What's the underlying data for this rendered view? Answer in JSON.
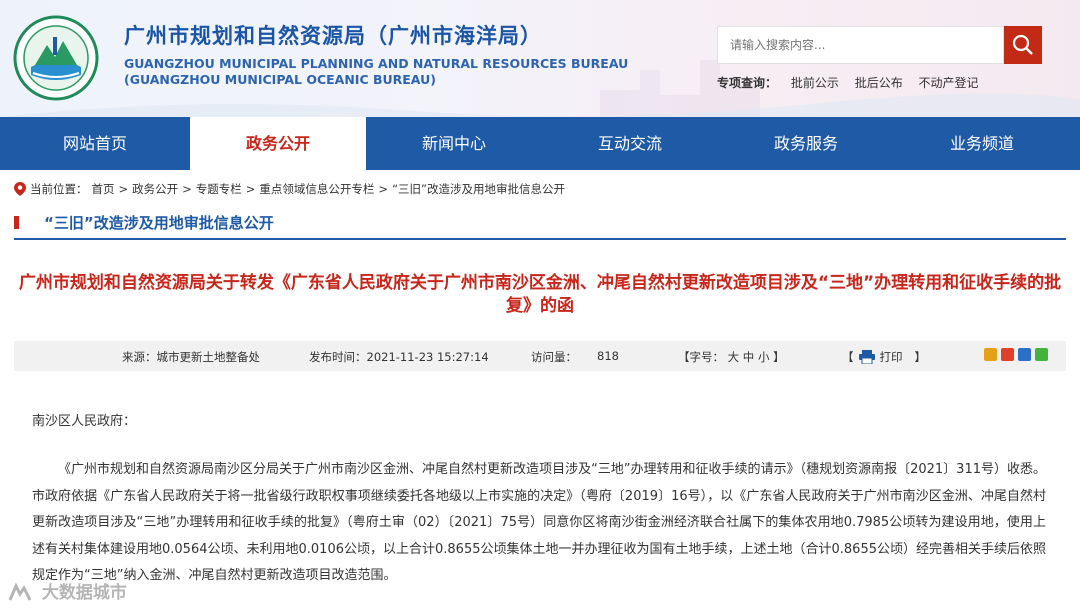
{
  "header": {
    "title": "广州市规划和自然资源局（广州市海洋局）",
    "title_en_1": "GUANGZHOU MUNICIPAL PLANNING AND NATURAL RESOURCES BUREAU",
    "title_en_2": "(GUANGZHOU MUNICIPAL OCEANIC BUREAU)",
    "search_placeholder": "请输入搜索内容...",
    "special_label": "专项查询：",
    "special_links": [
      "批前公示",
      "批后公布",
      "不动产登记"
    ]
  },
  "nav": {
    "items": [
      "网站首页",
      "政务公开",
      "新闻中心",
      "互动交流",
      "政务服务",
      "业务频道"
    ],
    "active_index": 1
  },
  "breadcrumb": {
    "label": "当前位置：",
    "items": [
      "首页",
      ">",
      "政务公开",
      ">",
      "专题专栏",
      ">",
      "重点领域信息公开专栏",
      ">",
      "“三旧”改造涉及用地审批信息公开"
    ]
  },
  "section": {
    "title": "“三旧”改造涉及用地审批信息公开"
  },
  "article": {
    "title": "广州市规划和自然资源局关于转发《广东省人民政府关于广州市南沙区金洲、冲尾自然村更新改造项目涉及“三地”办理转用和征收手续的批复》的函",
    "source": "来源：城市更新土地整备处",
    "publish": "发布时间：2021-11-23 15:27:14",
    "views_label": "访问量：",
    "views": "818",
    "font_size": "【字号： 大  中  小 】",
    "print_left": "【",
    "print": "打印",
    "print_right": "】",
    "salutation": "南沙区人民政府：",
    "paragraph": "《广州市规划和自然资源局南沙区分局关于广州市南沙区金洲、冲尾自然村更新改造项目涉及“三地”办理转用和征收手续的请示》（穗规划资源南报〔2021〕311号）收悉。市政府依据《广东省人民政府关于将一批省级行政职权事项继续委托各地级以上市实施的决定》（粤府〔2019〕16号），以《广东省人民政府关于广州市南沙区金洲、冲尾自然村更新改造项目涉及“三地”办理转用和征收手续的批复》（粤府土审（02）〔2021〕75号）同意你区将南沙街金洲经济联合社属下的集体农用地0.7985公顷转为建设用地，使用上述有关村集体建设用地0.0564公顷、未利用地0.0106公顷，以上合计0.8655公顷集体土地一并办理征收为国有土地手续，上述土地（合计0.8655公顷）经完善相关手续后依照规定作为“三地”纳入金洲、冲尾自然村更新改造项目改造范围。"
  },
  "watermark": "大数据城市",
  "colors": {
    "nav_bg": "#1f5aa6",
    "accent_red": "#c8261b",
    "title_blue": "#1b55a6"
  }
}
